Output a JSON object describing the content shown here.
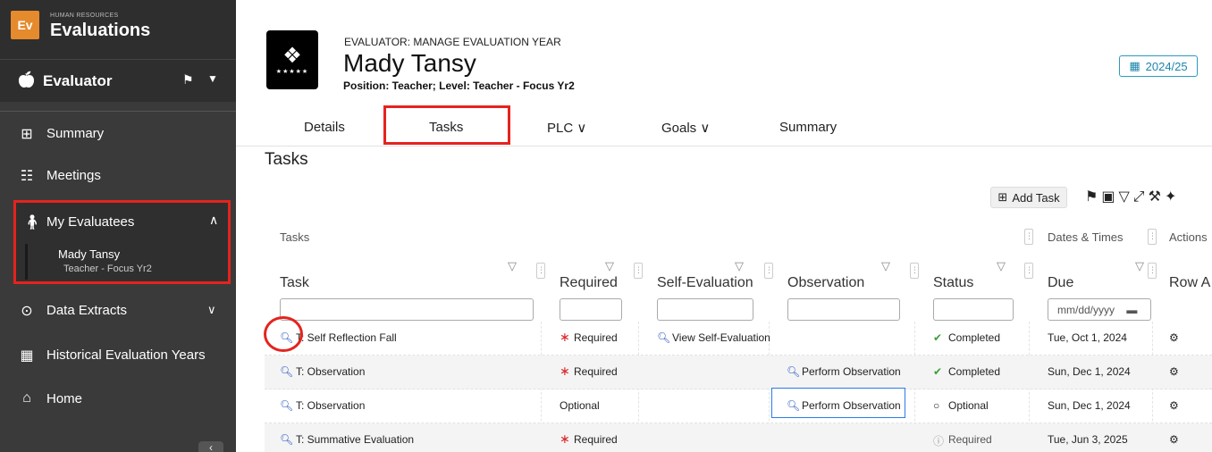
{
  "sidebar": {
    "brand_small": "HUMAN RESOURCES",
    "brand_title": "Evaluations",
    "brand_logo": "Ev",
    "role": "Evaluator",
    "items": [
      {
        "label": "Summary",
        "icon": "table-icon"
      },
      {
        "label": "Meetings",
        "icon": "people-icon"
      },
      {
        "label": "My Evaluatees",
        "icon": "person-icon"
      },
      {
        "label": "Data Extracts",
        "icon": "extract-icon"
      },
      {
        "label": "Historical Evaluation Years",
        "icon": "calendar-icon"
      },
      {
        "label": "Home",
        "icon": "home-icon"
      }
    ],
    "evaluatee": {
      "name": "Mady Tansy",
      "level": "Teacher - Focus Yr2"
    }
  },
  "header": {
    "caption": "EVALUATOR: MANAGE EVALUATION YEAR",
    "name": "Mady Tansy",
    "position": "Position: Teacher; Level: Teacher - Focus Yr2",
    "year": "2024/25"
  },
  "tabs": [
    "Details",
    "Tasks",
    "PLC ∨",
    "Goals ∨",
    "Summary"
  ],
  "page_title": "Tasks",
  "toolbar": {
    "add_task": "Add Task"
  },
  "table": {
    "groups": {
      "tasks": "Tasks",
      "dates": "Dates & Times",
      "actions": "Actions"
    },
    "columns": [
      "Task",
      "Required",
      "Self-Evaluation",
      "Observation",
      "Status",
      "Due",
      "Row A"
    ],
    "date_placeholder": "mm/dd/yyyy",
    "rows": [
      {
        "task": "T: Self Reflection Fall",
        "required": "Required",
        "required_flag": true,
        "self_eval": "View Self-Evaluation",
        "observation": "",
        "status": "Completed",
        "status_kind": "completed",
        "due": "Tue, Oct 1, 2024"
      },
      {
        "task": "T: Observation",
        "required": "Required",
        "required_flag": true,
        "self_eval": "",
        "observation": "Perform Observation",
        "status": "Completed",
        "status_kind": "completed",
        "due": "Sun, Dec 1, 2024"
      },
      {
        "task": "T: Observation",
        "required": "Optional",
        "required_flag": false,
        "self_eval": "",
        "observation": "Perform Observation",
        "status": "Optional",
        "status_kind": "optional",
        "due": "Sun, Dec 1, 2024"
      },
      {
        "task": "T: Summative Evaluation",
        "required": "Required",
        "required_flag": true,
        "self_eval": "",
        "observation": "",
        "status": "Required",
        "status_kind": "required",
        "due": "Tue, Jun 3, 2025"
      }
    ]
  },
  "colors": {
    "sidebar": "#3a3a3a",
    "highlight": "#e5231e",
    "link": "#2254c2",
    "accent": "#2b9bbf"
  }
}
